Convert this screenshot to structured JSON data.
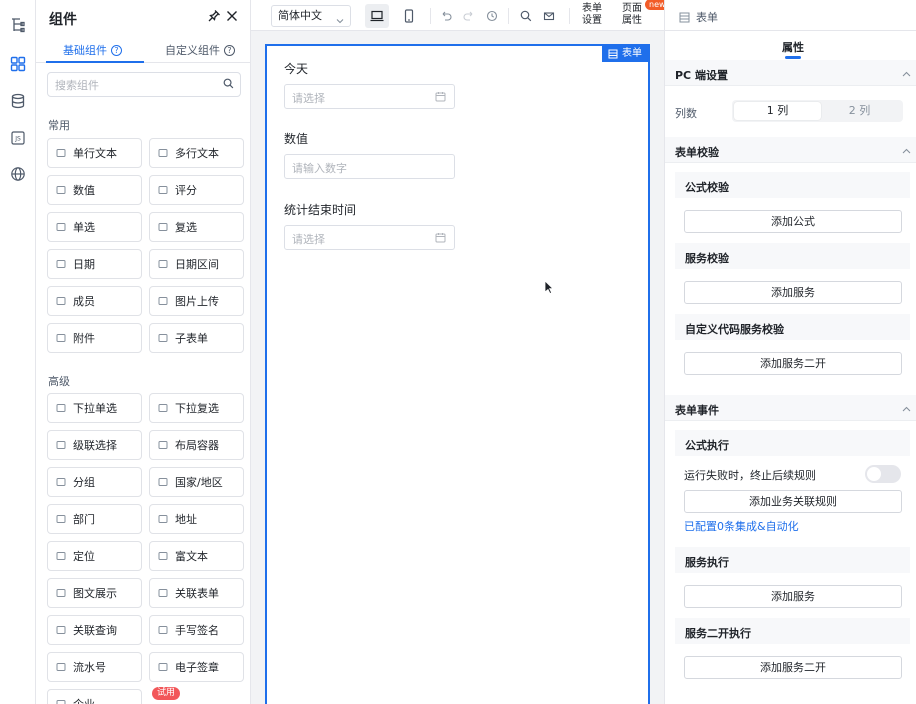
{
  "component_panel": {
    "title": "组件",
    "tabs": [
      {
        "label": "基础组件"
      },
      {
        "label": "自定义组件"
      }
    ],
    "search_placeholder": "搜索组件",
    "sections": [
      {
        "title": "常用",
        "items": [
          {
            "label": "单行文本",
            "icon": "single-line-text-icon"
          },
          {
            "label": "多行文本",
            "icon": "multi-line-text-icon"
          },
          {
            "label": "数值",
            "icon": "number-icon"
          },
          {
            "label": "评分",
            "icon": "star-icon"
          },
          {
            "label": "单选",
            "icon": "radio-icon"
          },
          {
            "label": "复选",
            "icon": "checkbox-icon"
          },
          {
            "label": "日期",
            "icon": "date-icon"
          },
          {
            "label": "日期区间",
            "icon": "date-range-icon"
          },
          {
            "label": "成员",
            "icon": "member-icon"
          },
          {
            "label": "图片上传",
            "icon": "image-upload-icon"
          },
          {
            "label": "附件",
            "icon": "attachment-icon"
          },
          {
            "label": "子表单",
            "icon": "subform-icon"
          }
        ]
      },
      {
        "title": "高级",
        "items": [
          {
            "label": "下拉单选",
            "icon": "dropdown-single-icon"
          },
          {
            "label": "下拉复选",
            "icon": "dropdown-multi-icon"
          },
          {
            "label": "级联选择",
            "icon": "cascade-icon"
          },
          {
            "label": "布局容器",
            "icon": "layout-icon"
          },
          {
            "label": "分组",
            "icon": "group-icon"
          },
          {
            "label": "国家/地区",
            "icon": "globe-icon"
          },
          {
            "label": "部门",
            "icon": "department-icon"
          },
          {
            "label": "地址",
            "icon": "address-icon"
          },
          {
            "label": "定位",
            "icon": "location-icon"
          },
          {
            "label": "富文本",
            "icon": "rich-text-icon"
          },
          {
            "label": "图文展示",
            "icon": "image-text-icon"
          },
          {
            "label": "关联表单",
            "icon": "related-form-icon"
          },
          {
            "label": "关联查询",
            "icon": "related-query-icon"
          },
          {
            "label": "手写签名",
            "icon": "signature-icon"
          },
          {
            "label": "流水号",
            "icon": "serial-number-icon"
          },
          {
            "label": "电子签章",
            "icon": "e-seal-icon"
          },
          {
            "label": "企业",
            "icon": "enterprise-icon"
          }
        ]
      }
    ],
    "trial_badge": "试用"
  },
  "toolbar": {
    "language": "简体中文",
    "form_settings": "表单设置",
    "page_properties": "页面属性",
    "new_badge": "new"
  },
  "form": {
    "tag": "表单",
    "fields": [
      {
        "label": "今天",
        "placeholder": "请选择",
        "type": "date"
      },
      {
        "label": "数值",
        "placeholder": "请输入数字",
        "type": "number"
      },
      {
        "label": "统计结束时间",
        "placeholder": "请选择",
        "type": "date"
      }
    ]
  },
  "right_panel": {
    "header": "表单",
    "tab": "属性",
    "pc_section": "PC 端设置",
    "columns_label": "列数",
    "column_options": [
      "1 列",
      "2 列"
    ],
    "validation_section": "表单校验",
    "formula_validation": "公式校验",
    "add_formula": "添加公式",
    "service_validation": "服务校验",
    "add_service": "添加服务",
    "custom_code_validation": "自定义代码服务校验",
    "add_service_dev": "添加服务二开",
    "events_section": "表单事件",
    "formula_execution": "公式执行",
    "stop_on_fail": "运行失败时，终止后续规则",
    "add_business_rule": "添加业务关联规则",
    "configured_link": "已配置0条集成&自动化",
    "service_execution": "服务执行",
    "add_service_2": "添加服务",
    "service_dev_execution": "服务二开执行",
    "add_service_dev_2": "添加服务二开"
  },
  "colors": {
    "accent": "#1f6feb",
    "badge_red": "#f2575a",
    "new_orange": "#f25c28"
  }
}
